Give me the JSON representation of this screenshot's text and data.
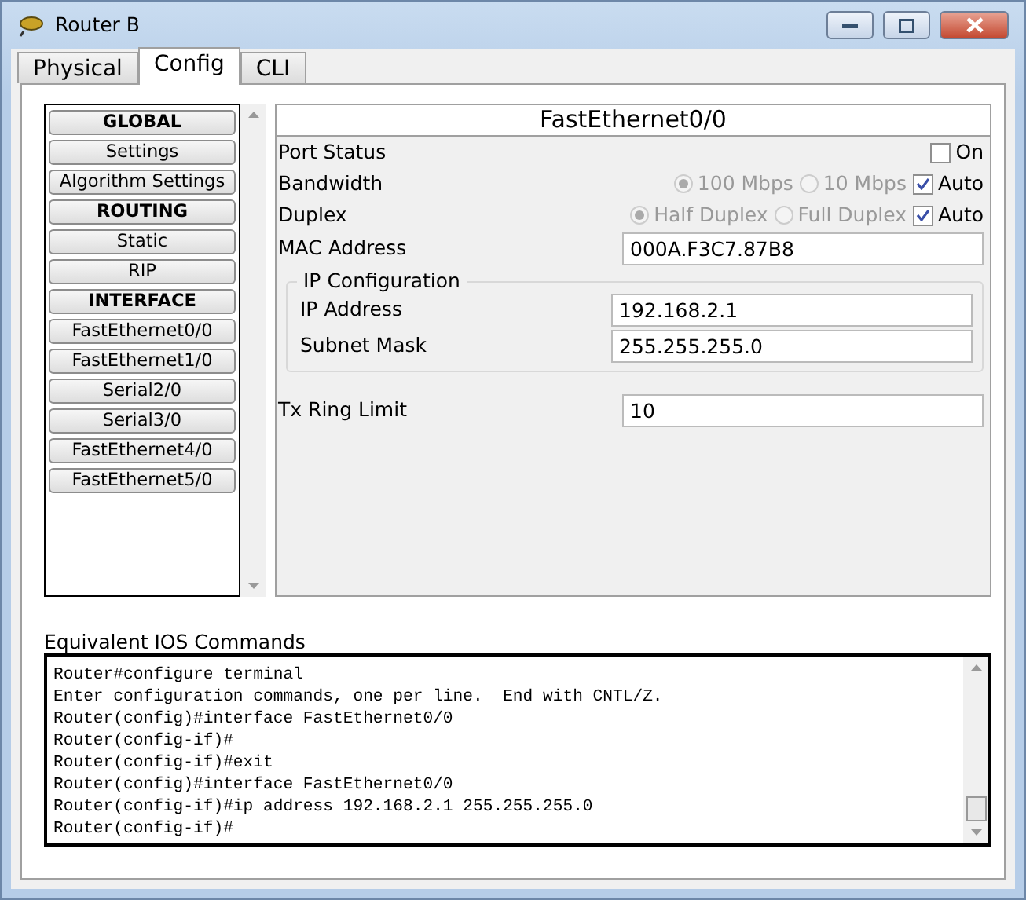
{
  "window": {
    "title": "Router B"
  },
  "tabs": [
    {
      "label": "Physical",
      "selected": false
    },
    {
      "label": "Config",
      "selected": true
    },
    {
      "label": "CLI",
      "selected": false
    }
  ],
  "sidebar": {
    "items": [
      {
        "label": "GLOBAL",
        "kind": "header"
      },
      {
        "label": "Settings",
        "kind": "item"
      },
      {
        "label": "Algorithm Settings",
        "kind": "item"
      },
      {
        "label": "ROUTING",
        "kind": "header"
      },
      {
        "label": "Static",
        "kind": "item"
      },
      {
        "label": "RIP",
        "kind": "item"
      },
      {
        "label": "INTERFACE",
        "kind": "header"
      },
      {
        "label": "FastEthernet0/0",
        "kind": "item"
      },
      {
        "label": "FastEthernet1/0",
        "kind": "item"
      },
      {
        "label": "Serial2/0",
        "kind": "item"
      },
      {
        "label": "Serial3/0",
        "kind": "item"
      },
      {
        "label": "FastEthernet4/0",
        "kind": "item"
      },
      {
        "label": "FastEthernet5/0",
        "kind": "item"
      }
    ]
  },
  "panel": {
    "title": "FastEthernet0/0",
    "port_status": {
      "label": "Port Status",
      "checkbox_label": "On",
      "checked": false
    },
    "bandwidth": {
      "label": "Bandwidth",
      "options": [
        {
          "label": "100 Mbps",
          "selected": true
        },
        {
          "label": "10 Mbps",
          "selected": false
        }
      ],
      "disabled": true,
      "auto_label": "Auto",
      "auto_checked": true
    },
    "duplex": {
      "label": "Duplex",
      "options": [
        {
          "label": "Half Duplex",
          "selected": true
        },
        {
          "label": "Full Duplex",
          "selected": false
        }
      ],
      "disabled": true,
      "auto_label": "Auto",
      "auto_checked": true
    },
    "mac_address": {
      "label": "MAC Address",
      "value": "000A.F3C7.87B8"
    },
    "ip_configuration": {
      "title": "IP Configuration",
      "fields": [
        {
          "label": "IP Address",
          "value": "192.168.2.1"
        },
        {
          "label": "Subnet Mask",
          "value": "255.255.255.0"
        }
      ]
    },
    "tx_ring_limit": {
      "label": "Tx Ring Limit",
      "value": "10"
    }
  },
  "ios_commands": {
    "label": "Equivalent IOS Commands",
    "lines": [
      "Router#configure terminal",
      "Enter configuration commands, one per line.  End with CNTL/Z.",
      "Router(config)#interface FastEthernet0/0",
      "Router(config-if)#",
      "Router(config-if)#exit",
      "Router(config)#interface FastEthernet0/0",
      "Router(config-if)#ip address 192.168.2.1 255.255.255.0",
      "Router(config-if)#"
    ]
  }
}
